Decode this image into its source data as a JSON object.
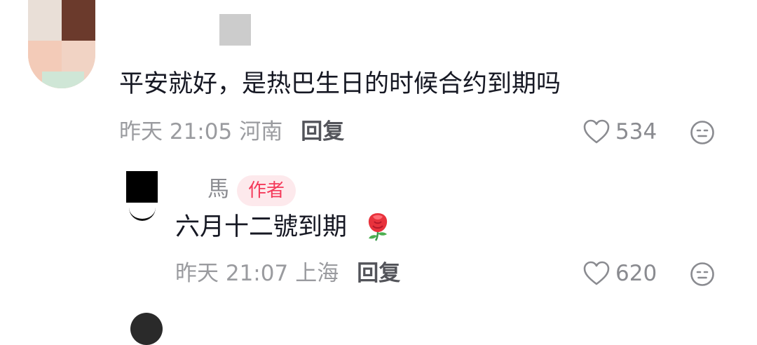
{
  "comment": {
    "text": "平安就好，是热巴生日的时候合约到期吗",
    "time": "昨天 21:05",
    "location": "河南",
    "reply_label": "回复",
    "likes": "534"
  },
  "reply": {
    "username": "馬",
    "badge": "作者",
    "text": "六月十二號到期",
    "emoji": "rose-icon",
    "time": "昨天 21:07",
    "location": "上海",
    "reply_label": "回复",
    "likes": "620"
  },
  "colors": {
    "badge_bg": "#fde9ec",
    "badge_text": "#f43a5a",
    "meta_text": "#9a9b9f"
  }
}
